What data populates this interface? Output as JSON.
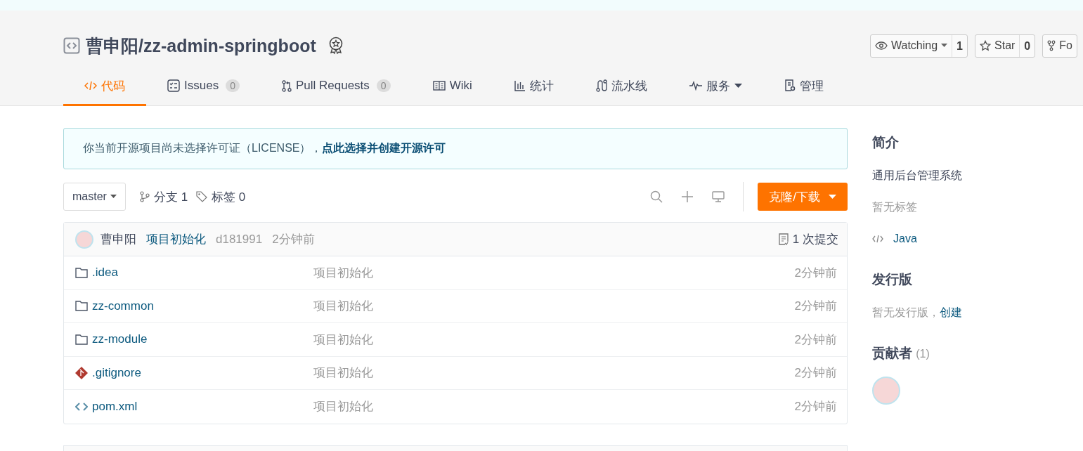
{
  "repo": {
    "title": "曹申阳/zz-admin-springboot"
  },
  "actions": [
    {
      "label": "Watching",
      "count": "1",
      "dropdown": true
    },
    {
      "label": "Star",
      "count": "0"
    },
    {
      "label": "Fo"
    }
  ],
  "tabs": [
    {
      "label": "代码",
      "selected": true
    },
    {
      "label": "Issues",
      "count": "0",
      "selected": false
    },
    {
      "label": "Pull Requests",
      "count": "0",
      "selected": false
    },
    {
      "label": "Wiki",
      "selected": false
    },
    {
      "label": "统计",
      "selected": false
    },
    {
      "label": "流水线",
      "selected": false
    },
    {
      "label": "服务",
      "dropdown": true,
      "selected": false
    },
    {
      "label": "管理",
      "selected": false
    }
  ],
  "notice": {
    "text": "你当前开源项目尚未选择许可证（LICENSE），",
    "link": "点此选择并创建开源许可"
  },
  "toolbar": {
    "branch": "master",
    "branches": "分支 1",
    "tags": "标签 0",
    "clone": "克隆/下载"
  },
  "commit": {
    "author": "曹申阳",
    "message": "项目初始化",
    "hash": "d181991",
    "time": "2分钟前",
    "count": "1 次提交"
  },
  "files": [
    {
      "kind": "folder",
      "name": ".idea",
      "message": "项目初始化",
      "time": "2分钟前"
    },
    {
      "kind": "folder",
      "name": "zz-common",
      "message": "项目初始化",
      "time": "2分钟前"
    },
    {
      "kind": "folder",
      "name": "zz-module",
      "message": "项目初始化",
      "time": "2分钟前"
    },
    {
      "kind": "git",
      "name": ".gitignore",
      "message": "项目初始化",
      "time": "2分钟前"
    },
    {
      "kind": "code",
      "name": "pom.xml",
      "message": "项目初始化",
      "time": "2分钟前"
    }
  ],
  "sidebar": {
    "intro_title": "简介",
    "description": "通用后台管理系统",
    "tags_empty": "暂无标签",
    "language": "Java",
    "releases_title": "发行版",
    "releases_empty": "暂无发行版，",
    "releases_link": "创建",
    "contributors_title": "贡献者",
    "contributors_count": "(1)"
  }
}
